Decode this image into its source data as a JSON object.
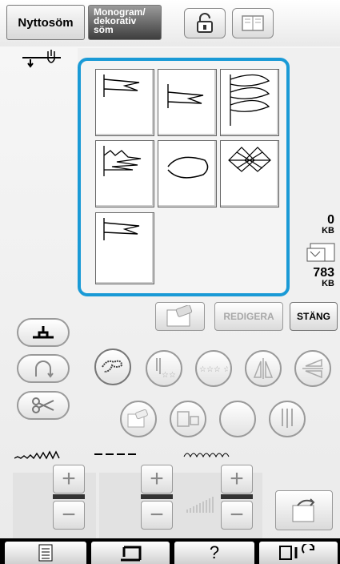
{
  "header": {
    "tab_nyttosom": "Nyttosöm",
    "tab_monogram_line1": "Monogram/",
    "tab_monogram_line2": "dekorativ",
    "tab_monogram_line3": "söm"
  },
  "memory": {
    "used_value": "0",
    "used_unit": "KB",
    "free_value": "783",
    "free_unit": "KB"
  },
  "actions": {
    "edit_label": "REDIGERA",
    "close_label": "STÄNG"
  },
  "bottom": {
    "help_label": "?"
  },
  "colors": {
    "selection_border": "#1a9ad6",
    "monogram_tab_bg": "#4a4a4a"
  },
  "icons": {
    "lock": "lock-open-icon",
    "book": "book-icon",
    "home": "home-icon"
  }
}
